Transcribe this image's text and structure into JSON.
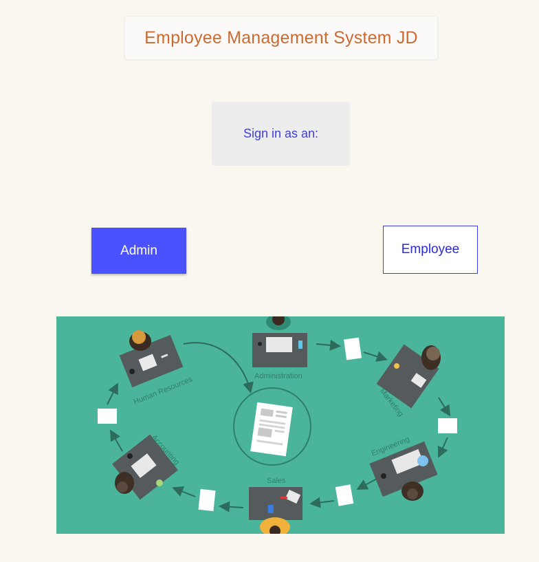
{
  "header": {
    "title": "Employee Management System JD"
  },
  "signin": {
    "prompt": "Sign in as an:"
  },
  "buttons": {
    "admin_label": "Admin",
    "employee_label": "Employee"
  },
  "illustration": {
    "background_color": "#4ab59a",
    "departments": [
      "Administration",
      "Marketing",
      "Engineering",
      "Sales",
      "Accounting",
      "Human Resources"
    ]
  },
  "colors": {
    "title": "#cc6a31",
    "accent": "#4a52ff",
    "prompt": "#3d3de0"
  }
}
